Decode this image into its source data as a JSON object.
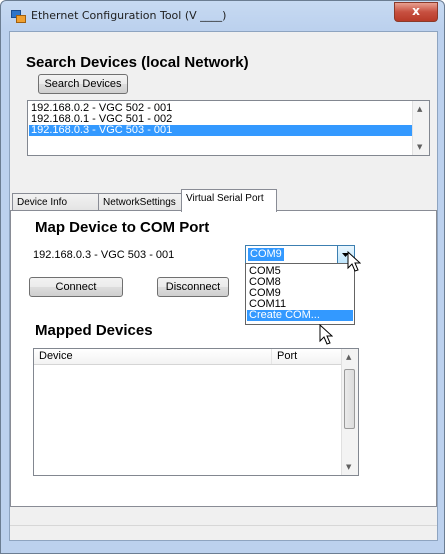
{
  "window": {
    "title": "Ethernet Configuration Tool (V ____)",
    "close_label": "x"
  },
  "search": {
    "title": "Search Devices (local Network)",
    "button_label": "Search Devices",
    "devices": [
      {
        "label": "192.168.0.2 - VGC 502 - 001",
        "selected": false
      },
      {
        "label": "192.168.0.1 - VGC 501 - 002",
        "selected": false
      },
      {
        "label": "192.168.0.3 - VGC 503 - 001",
        "selected": true
      }
    ]
  },
  "tabs": [
    {
      "label": "Device Info",
      "active": false
    },
    {
      "label": "NetworkSettings",
      "active": false
    },
    {
      "label": "Virtual Serial Port",
      "active": true
    }
  ],
  "serial": {
    "title": "Map Device to COM Port",
    "device_label": "192.168.0.3 - VGC 503 - 001",
    "com_value": "COM9",
    "options": [
      {
        "label": "COM5",
        "selected": false
      },
      {
        "label": "COM8",
        "selected": false
      },
      {
        "label": "COM9",
        "selected": false
      },
      {
        "label": "COM11",
        "selected": false
      },
      {
        "label": "Create COM...",
        "selected": true
      }
    ],
    "connect_label": "Connect",
    "disconnect_label": "Disconnect"
  },
  "mapped": {
    "title": "Mapped Devices",
    "columns": [
      "Device",
      "Port"
    ]
  }
}
